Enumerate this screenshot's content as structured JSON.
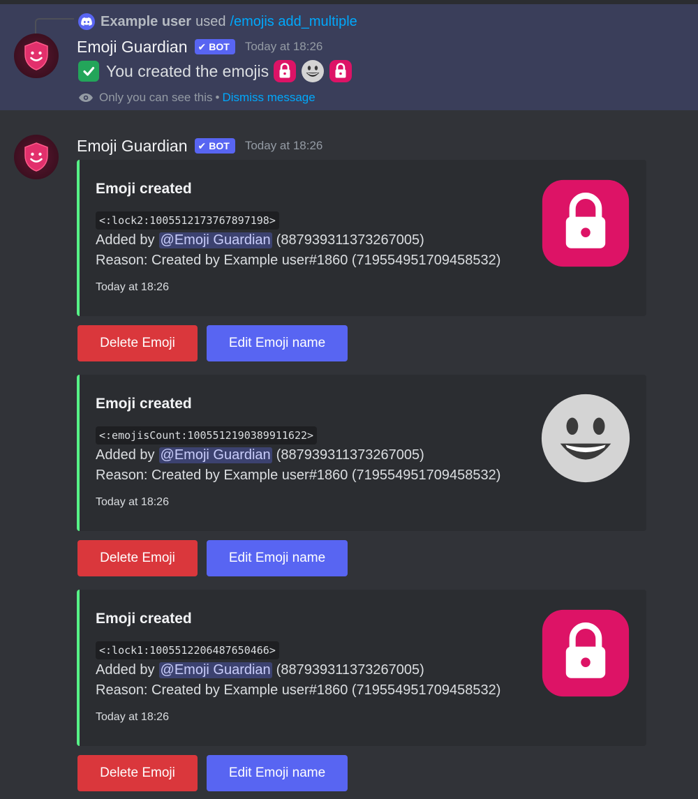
{
  "colors": {
    "background": "#313338",
    "ephemeral_bg": "#3a3e5a",
    "embed_bg": "#2b2d31",
    "embed_accent": "#57f287",
    "danger_button": "#da373c",
    "primary_button": "#5865f2",
    "link": "#00a8fc",
    "lock_pink": "#dd1366"
  },
  "interaction": {
    "user": "Example user",
    "used_label": "used",
    "command": "/emojis add_multiple"
  },
  "ephemeral_message": {
    "author": "Emoji Guardian",
    "bot_tag": "BOT",
    "timestamp": "Today at 18:26",
    "text": "You created the emojis",
    "inline_emojis": [
      "lock-icon",
      "grinning-face-icon",
      "lock-icon"
    ],
    "only_you": "Only you can see this",
    "separator": "•",
    "dismiss": "Dismiss message"
  },
  "message": {
    "author": "Emoji Guardian",
    "bot_tag": "BOT",
    "timestamp": "Today at 18:26"
  },
  "embeds": [
    {
      "title": "Emoji created",
      "code": "<:lock2:1005512173767897198>",
      "added_by_label": "Added by",
      "mention": "@Emoji Guardian",
      "user_id": "(887939311373267005)",
      "reason": "Reason: Created by Example user#1860 (719554951709458532)",
      "time": "Today at 18:26",
      "thumbnail": "lock-icon",
      "delete_label": "Delete Emoji",
      "edit_label": "Edit Emoji name"
    },
    {
      "title": "Emoji created",
      "code": "<:emojisCount:1005512190389911622>",
      "added_by_label": "Added by",
      "mention": "@Emoji Guardian",
      "user_id": "(887939311373267005)",
      "reason": "Reason: Created by Example user#1860 (719554951709458532)",
      "time": "Today at 18:26",
      "thumbnail": "grinning-face-icon",
      "delete_label": "Delete Emoji",
      "edit_label": "Edit Emoji name"
    },
    {
      "title": "Emoji created",
      "code": "<:lock1:1005512206487650466>",
      "added_by_label": "Added by",
      "mention": "@Emoji Guardian",
      "user_id": "(887939311373267005)",
      "reason": "Reason: Created by Example user#1860 (719554951709458532)",
      "time": "Today at 18:26",
      "thumbnail": "lock-icon",
      "delete_label": "Delete Emoji",
      "edit_label": "Edit Emoji name"
    }
  ]
}
